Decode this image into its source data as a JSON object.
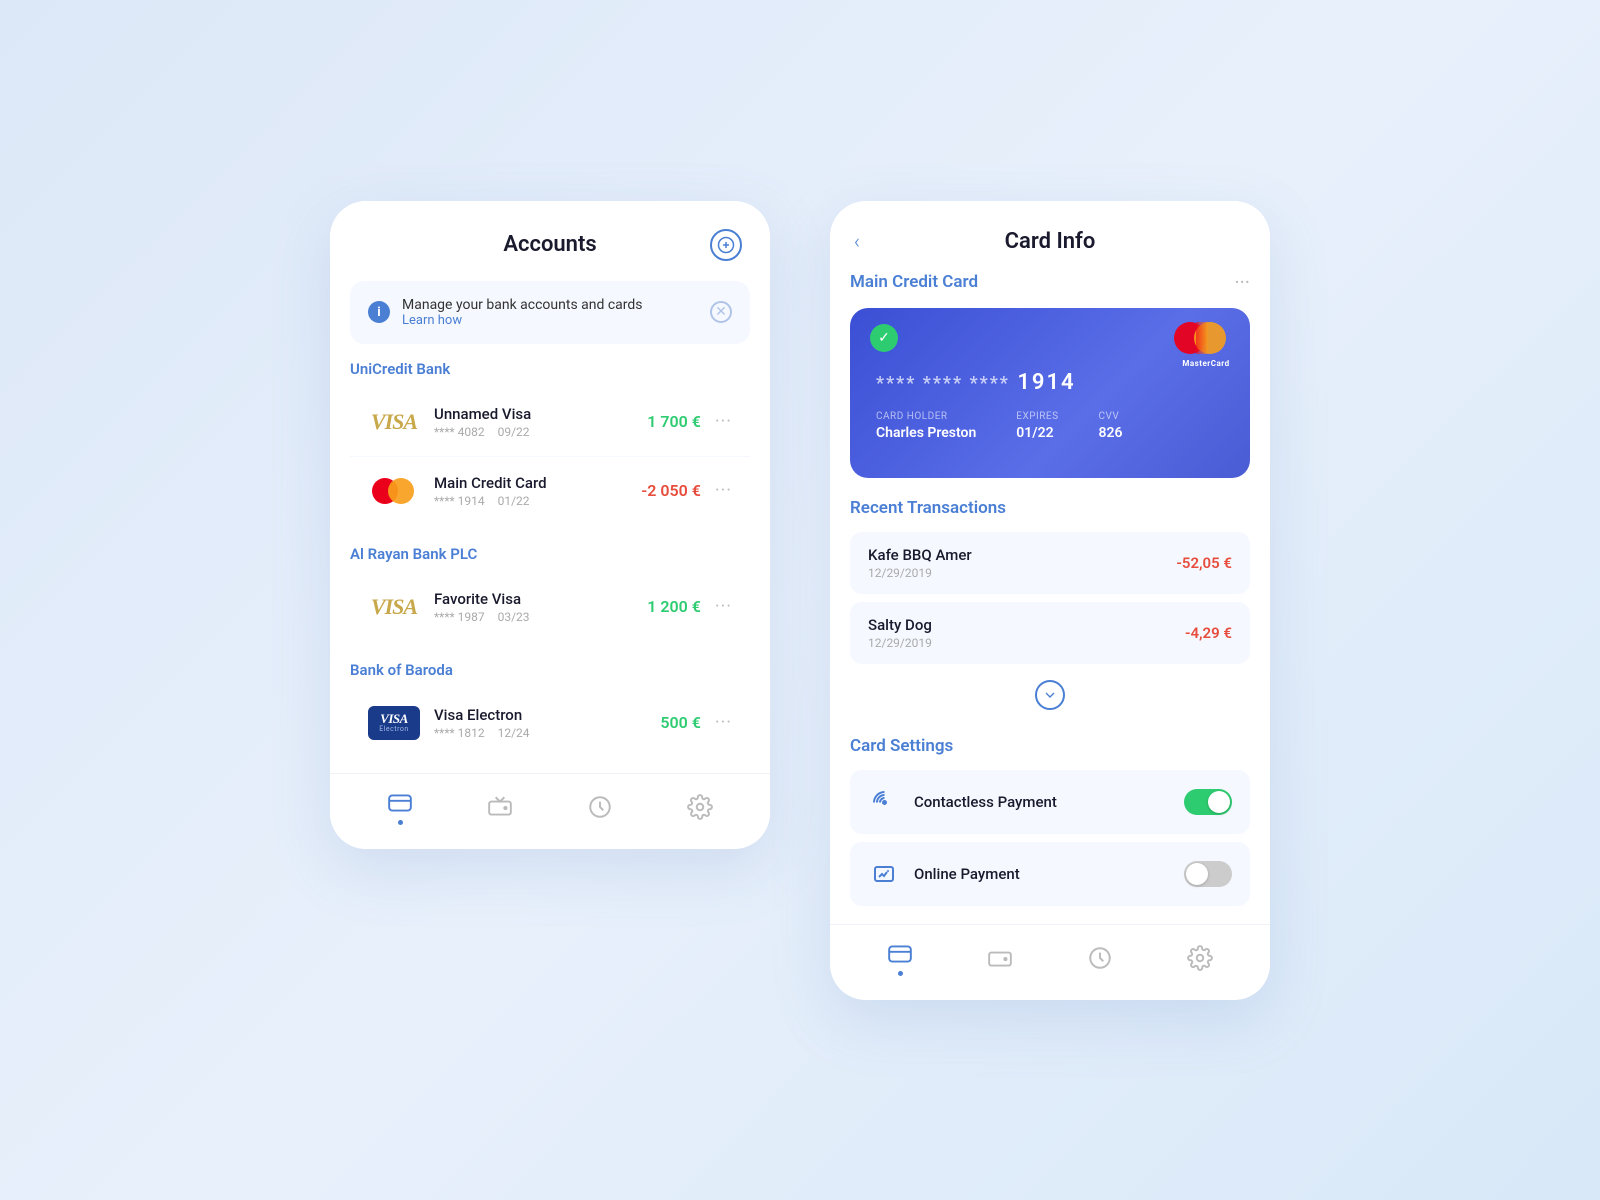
{
  "left_phone": {
    "title": "Accounts",
    "add_button_label": "+",
    "info_banner": {
      "text": "Manage your bank accounts and cards",
      "learn_link": "Learn how"
    },
    "banks": [
      {
        "name": "UniCredit Bank",
        "cards": [
          {
            "type": "visa",
            "card_name": "Unnamed Visa",
            "masked_number": "**** 4082",
            "expiry": "09/22",
            "amount": "1 700 €",
            "amount_type": "positive"
          },
          {
            "type": "mastercard",
            "card_name": "Main Credit Card",
            "masked_number": "**** 1914",
            "expiry": "01/22",
            "amount": "-2 050 €",
            "amount_type": "negative"
          }
        ]
      },
      {
        "name": "Al Rayan Bank PLC",
        "cards": [
          {
            "type": "visa",
            "card_name": "Favorite Visa",
            "masked_number": "**** 1987",
            "expiry": "03/23",
            "amount": "1 200 €",
            "amount_type": "positive"
          }
        ]
      },
      {
        "name": "Bank of Baroda",
        "cards": [
          {
            "type": "visa-electron",
            "card_name": "Visa Electron",
            "masked_number": "**** 1812",
            "expiry": "12/24",
            "amount": "500 €",
            "amount_type": "positive"
          }
        ]
      }
    ],
    "nav": [
      {
        "icon": "card-icon",
        "active": true
      },
      {
        "icon": "wallet-icon",
        "active": false
      },
      {
        "icon": "clock-icon",
        "active": false
      },
      {
        "icon": "settings-icon",
        "active": false
      }
    ]
  },
  "right_phone": {
    "title": "Card Info",
    "back_label": "‹",
    "card_section_title": "Main Credit Card",
    "credit_card": {
      "number_masked": "**** **** ****",
      "number_last4": "1914",
      "card_holder_label": "CARD HOLDER",
      "card_holder": "Charles Preston",
      "expires_label": "EXPIRES",
      "expires": "01/22",
      "cvv_label": "CVV",
      "cvv": "826"
    },
    "transactions_title": "Recent Transactions",
    "transactions": [
      {
        "name": "Kafe BBQ Amer",
        "date": "12/29/2019",
        "amount": "-52,05 €"
      },
      {
        "name": "Salty Dog",
        "date": "12/29/2019",
        "amount": "-4,29 €"
      }
    ],
    "card_settings_title": "Card Settings",
    "settings": [
      {
        "icon": "contactless-icon",
        "label": "Contactless Payment",
        "enabled": true
      },
      {
        "icon": "online-payment-icon",
        "label": "Online Payment",
        "enabled": false
      }
    ],
    "nav": [
      {
        "icon": "card-icon",
        "active": true
      },
      {
        "icon": "wallet-icon",
        "active": false
      },
      {
        "icon": "clock-icon",
        "active": false
      },
      {
        "icon": "settings-icon",
        "active": false
      }
    ]
  }
}
